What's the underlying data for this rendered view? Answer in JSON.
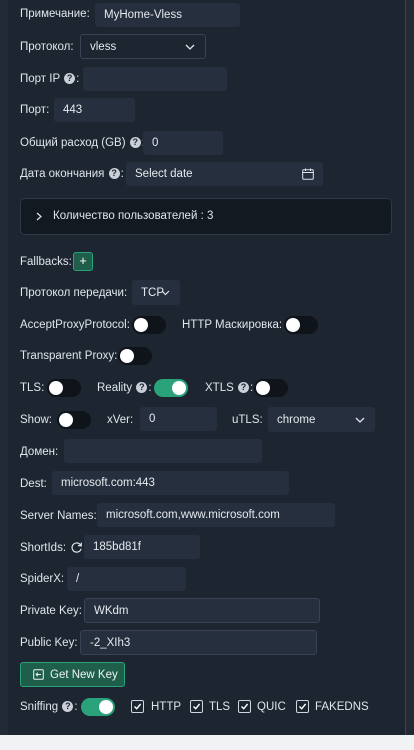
{
  "remark": {
    "label": "Примечание:",
    "value": "MyHome-Vless"
  },
  "protocol": {
    "label": "Протокол:",
    "value": "vless"
  },
  "port_ip": {
    "label": "Порт IP",
    "q": "?",
    "colon": ":",
    "value": ""
  },
  "port": {
    "label": "Порт:",
    "value": "443"
  },
  "total": {
    "label": "Общий расход (GB)",
    "q": "?",
    "colon": ":",
    "value": "0"
  },
  "expiry": {
    "label": "Дата окончания",
    "q": "?",
    "colon": ":",
    "placeholder": "Select date"
  },
  "clients": {
    "label": "Количество пользователей : 3"
  },
  "fallbacks": {
    "label": "Fallbacks:",
    "add": "+"
  },
  "network": {
    "label": "Протокол передачи:",
    "value": "TCP"
  },
  "accept_proxy": {
    "label": "AcceptProxyProtocol:",
    "on": false
  },
  "http_mask": {
    "label": "HTTP Маскировка:",
    "on": false
  },
  "transparent": {
    "label": "Transparent Proxy:",
    "on": false
  },
  "tls": {
    "label": "TLS:",
    "on": false
  },
  "reality": {
    "label": "Reality",
    "q": "?",
    "colon": ":",
    "on": true
  },
  "xtls": {
    "label": "XTLS",
    "q": "?",
    "colon": ":",
    "on": false
  },
  "show": {
    "label": "Show:",
    "on": false
  },
  "xver": {
    "label": "xVer:",
    "value": "0"
  },
  "utls": {
    "label": "uTLS:",
    "value": "chrome"
  },
  "domain": {
    "label": "Домен:",
    "value": ""
  },
  "dest": {
    "label": "Dest:",
    "value": "microsoft.com:443"
  },
  "server_names": {
    "label": "Server Names:",
    "value": "microsoft.com,www.microsoft.com"
  },
  "short_ids": {
    "label": "ShortIds:",
    "value": "185bd81f"
  },
  "spider_x": {
    "label": "SpiderX:",
    "value": "/"
  },
  "private_key": {
    "label": "Private Key:",
    "value": "WKdm"
  },
  "public_key": {
    "label": "Public Key:",
    "value": "-2_XIh3"
  },
  "get_new_key": {
    "label": "Get New Key"
  },
  "sniffing": {
    "label": "Sniffing",
    "q": "?",
    "colon": ":",
    "on": true,
    "options": [
      {
        "label": "HTTP",
        "checked": true
      },
      {
        "label": "TLS",
        "checked": true
      },
      {
        "label": "QUIC",
        "checked": true
      },
      {
        "label": "FAKEDNS",
        "checked": true
      }
    ]
  },
  "colors": {
    "accent": "#2aa37a",
    "panel": "#1c2530",
    "field": "#262f3d"
  }
}
